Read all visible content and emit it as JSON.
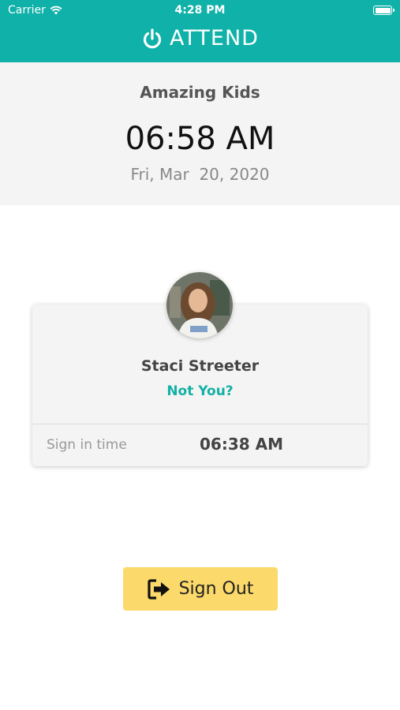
{
  "status_bar": {
    "carrier": "Carrier",
    "time": "4:28 PM"
  },
  "app": {
    "brand": "ATTEND",
    "icon": "power-icon",
    "accent_color": "#0fb1a8"
  },
  "header": {
    "organization": "Amazing Kids",
    "clock": "06:58 AM",
    "date": "Fri, Mar  20, 2020"
  },
  "person": {
    "name": "Staci Streeter",
    "not_you_label": "Not You?",
    "sign_in_label": "Sign in time",
    "sign_in_time": "06:38 AM"
  },
  "actions": {
    "sign_out_label": "Sign Out",
    "sign_out_icon": "sign-out-icon",
    "button_color": "#fbd96a"
  }
}
